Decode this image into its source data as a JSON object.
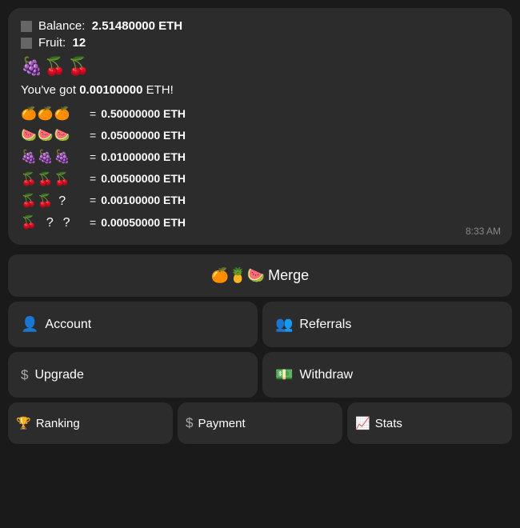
{
  "chat": {
    "balance_label": "Balance:",
    "balance_value": "2.51480000 ETH",
    "fruit_label": "Fruit:",
    "fruit_value": "12",
    "fruit_icons": "🍇🍒🍒",
    "you_got_prefix": "You've got ",
    "you_got_value": "0.00100000",
    "you_got_suffix": " ETH!",
    "fruit_rows": [
      {
        "emojis": "🍊🍊🍊",
        "value": "0.50000000 ETH"
      },
      {
        "emojis": "🍉🍉🍉",
        "value": "0.05000000 ETH"
      },
      {
        "emojis": "🍇🍇🍇",
        "value": "0.01000000 ETH"
      },
      {
        "emojis": "🍒🍒🍒",
        "value": "0.00500000 ETH"
      },
      {
        "emojis": "🍒🍒 ?",
        "value": "0.00100000 ETH"
      },
      {
        "emojis": "🍒 ? ?",
        "value": "0.00050000 ETH"
      }
    ],
    "timestamp": "8:33 AM"
  },
  "buttons": {
    "merge": {
      "label": "Merge",
      "icon": "🍊🍍🍉"
    },
    "account": {
      "label": "Account",
      "icon": "👤"
    },
    "referrals": {
      "label": "Referrals",
      "icon": "👥"
    },
    "upgrade": {
      "label": "Upgrade",
      "icon": "$"
    },
    "withdraw": {
      "label": "Withdraw",
      "icon": "💵"
    },
    "ranking": {
      "label": "Ranking",
      "icon": "🏆"
    },
    "payment": {
      "label": "Payment",
      "icon": "$"
    },
    "stats": {
      "label": "Stats",
      "icon": "📈"
    }
  }
}
